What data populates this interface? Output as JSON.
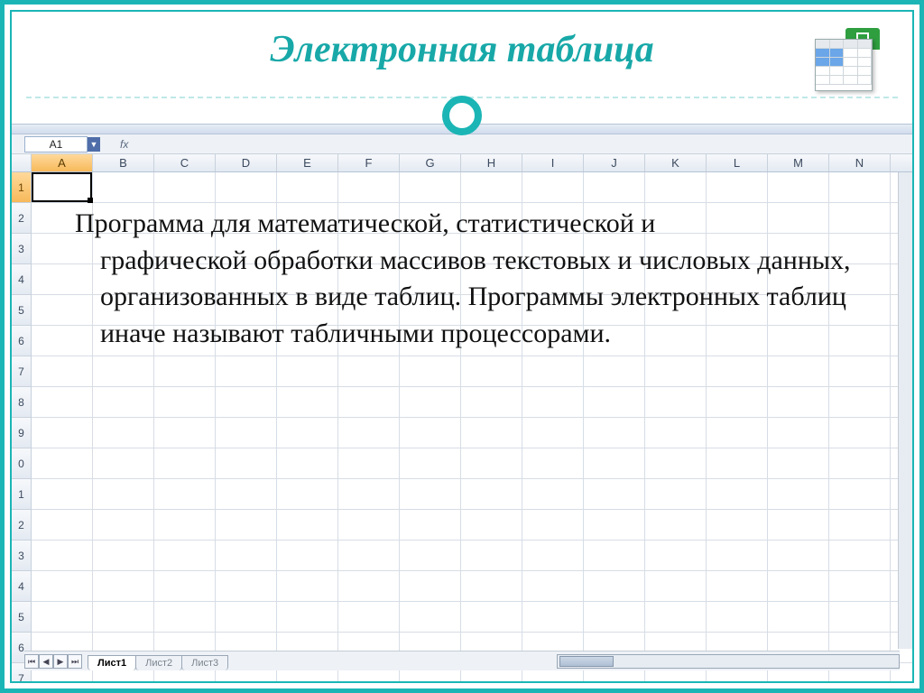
{
  "title": "Электронная таблица",
  "body_first": "Программа для математической, статистической и",
  "body_rest": "графической обработки массивов текстовых и числовых данных, организованных в виде таблиц. Программы электронных таблиц иначе называют табличными процессорами.",
  "namebox": "A1",
  "fx": "fx",
  "columns": [
    "A",
    "B",
    "C",
    "D",
    "E",
    "F",
    "G",
    "H",
    "I",
    "J",
    "K",
    "L",
    "M",
    "N"
  ],
  "rows": [
    "1",
    "2",
    "3",
    "4",
    "5",
    "6",
    "7",
    "8",
    "9",
    "0",
    "1",
    "2",
    "3",
    "4",
    "5",
    "6",
    "7"
  ],
  "active_col": "A",
  "active_row": "1",
  "tabs": [
    "Лист1",
    "Лист2",
    "Лист3"
  ],
  "active_tab": "Лист1"
}
